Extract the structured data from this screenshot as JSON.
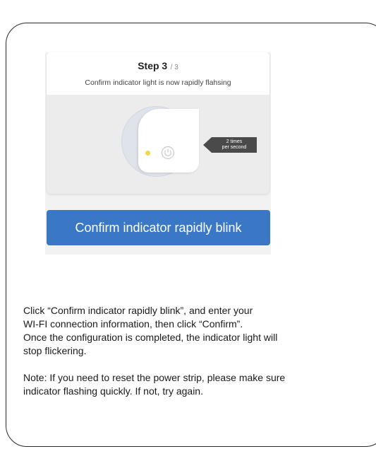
{
  "step": {
    "title": "Step 3",
    "total": "/ 3",
    "description": "Confirm indicator light is now rapidly flahsing"
  },
  "illustration": {
    "callout_line1": "2 times",
    "callout_line2": "per second",
    "indicator_color": "#f0d84a",
    "icons": [
      "power-icon"
    ]
  },
  "confirm_button": {
    "label": "Confirm indicator rapidly blink",
    "color": "#3a78c6"
  },
  "instructions": {
    "line1": "Click “Confirm indicator rapidly blink”, and enter your",
    "line2": "WI-FI connection information, then click “Confirm”.",
    "line3": "Once the configuration is completed, the indicator light will",
    "line4": "stop flickering.",
    "note1": "Note: If you need to reset the power strip, please make sure",
    "note2": "indicator flashing quickly. If not, try again."
  }
}
